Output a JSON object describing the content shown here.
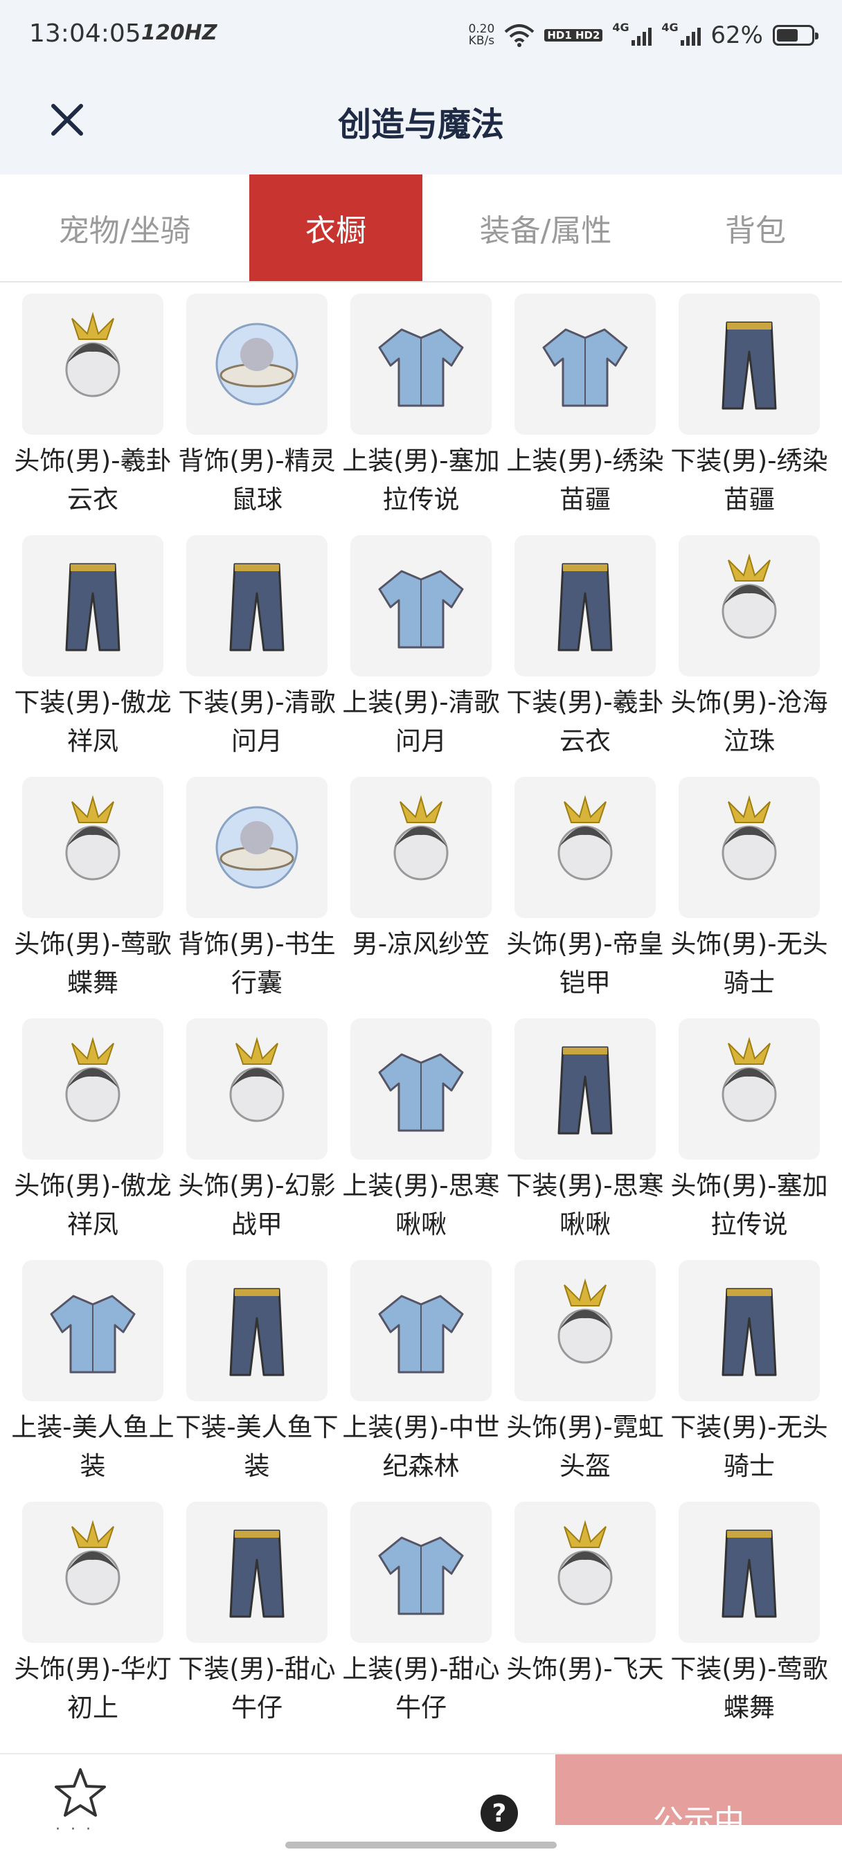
{
  "status_bar": {
    "time": "13:04:05",
    "refresh": "120HZ",
    "net_speed_value": "0.20",
    "net_speed_unit": "KB/s",
    "hd_badge": "HD1 HD2",
    "sig1_label": "4G",
    "sig2_label": "4G",
    "battery_pct": "62%",
    "battery_level": 0.62
  },
  "header": {
    "title": "创造与魔法"
  },
  "tabs": [
    {
      "label": "宠物/坐骑",
      "active": false
    },
    {
      "label": "衣橱",
      "active": true
    },
    {
      "label": "装备/属性",
      "active": false
    },
    {
      "label": "背包",
      "active": false
    }
  ],
  "items": [
    {
      "label": "头饰(男)-羲卦云衣",
      "icon": "headwear-icon"
    },
    {
      "label": "背饰(男)-精灵鼠球",
      "icon": "backpiece-icon"
    },
    {
      "label": "上装(男)-塞加拉传说",
      "icon": "top-garment-icon"
    },
    {
      "label": "上装(男)-绣染苗疆",
      "icon": "top-garment-icon"
    },
    {
      "label": "下装(男)-绣染苗疆",
      "icon": "bottom-garment-icon"
    },
    {
      "label": "下装(男)-傲龙祥凤",
      "icon": "bottom-garment-icon"
    },
    {
      "label": "下装(男)-清歌问月",
      "icon": "bottom-garment-icon"
    },
    {
      "label": "上装(男)-清歌问月",
      "icon": "top-garment-icon"
    },
    {
      "label": "下装(男)-羲卦云衣",
      "icon": "bottom-garment-icon"
    },
    {
      "label": "头饰(男)-沧海泣珠",
      "icon": "headwear-icon"
    },
    {
      "label": "头饰(男)-莺歌蝶舞",
      "icon": "headwear-icon"
    },
    {
      "label": "背饰(男)-书生行囊",
      "icon": "backpiece-icon"
    },
    {
      "label": "男-凉风纱笠",
      "icon": "headwear-icon"
    },
    {
      "label": "头饰(男)-帝皇铠甲",
      "icon": "headwear-icon"
    },
    {
      "label": "头饰(男)-无头骑士",
      "icon": "headwear-icon"
    },
    {
      "label": "头饰(男)-傲龙祥凤",
      "icon": "headwear-icon"
    },
    {
      "label": "头饰(男)-幻影战甲",
      "icon": "headwear-icon"
    },
    {
      "label": "上装(男)-思寒啾啾",
      "icon": "top-garment-icon"
    },
    {
      "label": "下装(男)-思寒啾啾",
      "icon": "bottom-garment-icon"
    },
    {
      "label": "头饰(男)-塞加拉传说",
      "icon": "headwear-icon"
    },
    {
      "label": "上装-美人鱼上装",
      "icon": "top-garment-icon"
    },
    {
      "label": "下装-美人鱼下装",
      "icon": "bottom-garment-icon"
    },
    {
      "label": "上装(男)-中世纪森林",
      "icon": "top-garment-icon"
    },
    {
      "label": "头饰(男)-霓虹头盔",
      "icon": "headwear-icon"
    },
    {
      "label": "下装(男)-无头骑士",
      "icon": "bottom-garment-icon"
    },
    {
      "label": "头饰(男)-华灯初上",
      "icon": "headwear-icon"
    },
    {
      "label": "下装(男)-甜心牛仔",
      "icon": "bottom-garment-icon"
    },
    {
      "label": "上装(男)-甜心牛仔",
      "icon": "top-garment-icon"
    },
    {
      "label": "头饰(男)-飞天",
      "icon": "headwear-icon"
    },
    {
      "label": "下装(男)-莺歌蝶舞",
      "icon": "bottom-garment-icon"
    }
  ],
  "bottom_bar": {
    "help_label": "?",
    "publish_label": "公示中",
    "fav_dots": "· · ·",
    "fav_icon": "star-icon"
  },
  "colors": {
    "accent": "#c8342f",
    "publish_bg": "#e5a09d",
    "header_bg": "#f1f4f8"
  }
}
